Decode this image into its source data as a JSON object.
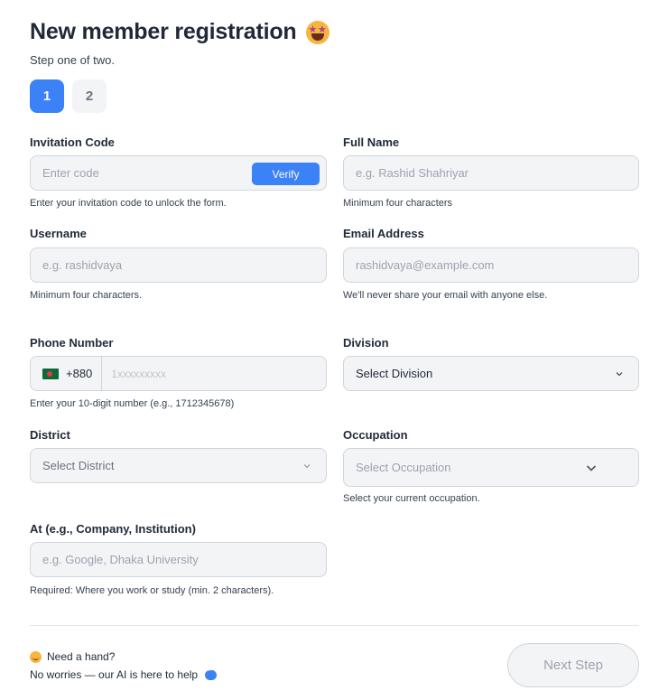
{
  "header": {
    "title": "New member registration",
    "title_emoji": "star-struck-emoji",
    "subtitle": "Step one of two."
  },
  "steps": [
    {
      "label": "1",
      "active": true
    },
    {
      "label": "2",
      "active": false
    }
  ],
  "form": {
    "invitation": {
      "label": "Invitation Code",
      "placeholder": "Enter code",
      "button": "Verify",
      "help": "Enter your invitation code to unlock the form."
    },
    "full_name": {
      "label": "Full Name",
      "placeholder": "e.g. Rashid Shahriyar",
      "help": "Minimum four characters"
    },
    "username": {
      "label": "Username",
      "placeholder": "e.g. rashidvaya",
      "help": "Minimum four characters."
    },
    "email": {
      "label": "Email Address",
      "placeholder": "rashidvaya@example.com",
      "help": "We'll never share your email with anyone else."
    },
    "phone": {
      "label": "Phone Number",
      "country_code": "+880",
      "flag": "bangladesh-flag",
      "placeholder": "1xxxxxxxxx",
      "help": "Enter your 10-digit number (e.g., 1712345678)"
    },
    "division": {
      "label": "Division",
      "value": "Select Division"
    },
    "district": {
      "label": "District",
      "value": "Select District"
    },
    "occupation": {
      "label": "Occupation",
      "value": "Select Occupation",
      "help": "Select your current occupation."
    },
    "at": {
      "label": "At (e.g., Company, Institution)",
      "placeholder": "e.g. Google, Dhaka University",
      "help": "Required: Where you work or study (min. 2 characters)."
    }
  },
  "footer": {
    "need_hand": "Need a hand?",
    "ai_note": "No worries — our AI is here to help",
    "next_button": "Next Step"
  },
  "colors": {
    "accent": "#3b82f6",
    "field_bg": "#f3f4f6",
    "border": "#d1d5db"
  }
}
